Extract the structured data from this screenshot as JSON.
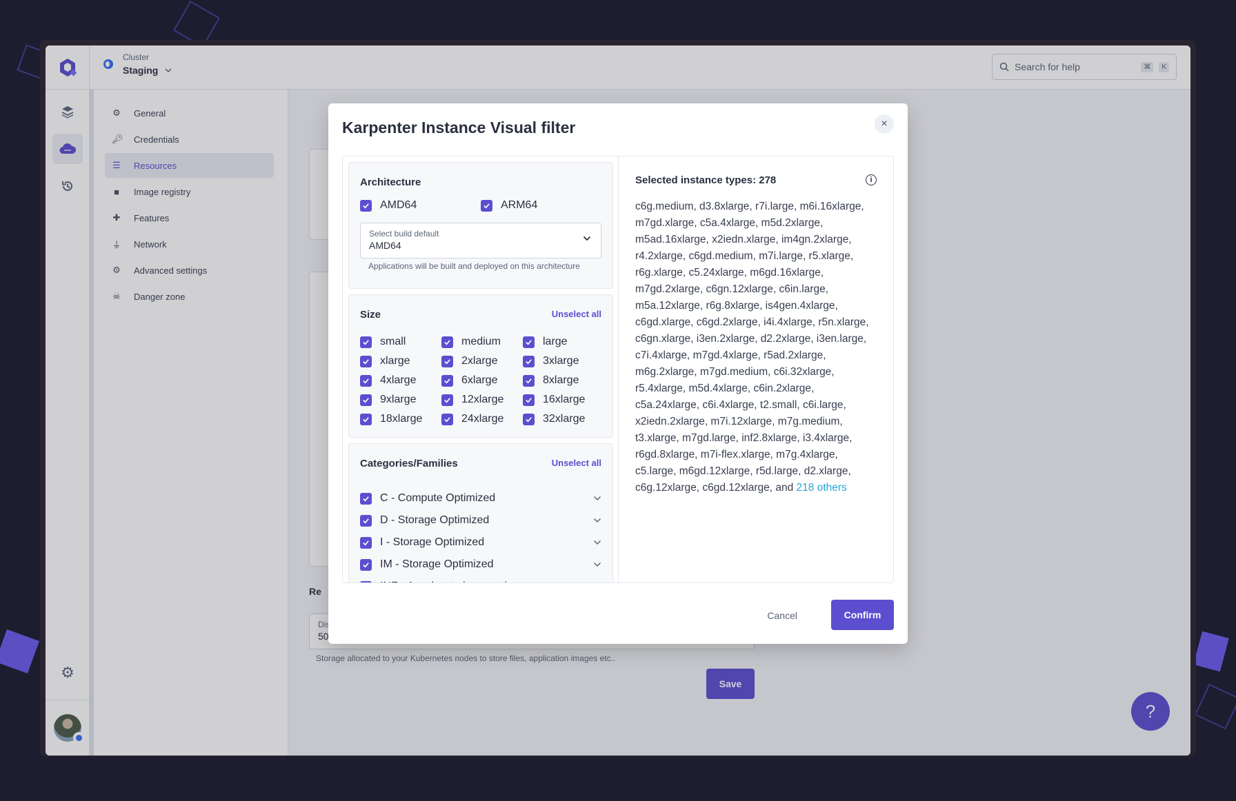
{
  "header": {
    "cluster_label": "Cluster",
    "cluster_name": "Staging",
    "search_placeholder": "Search for help",
    "shortcut_keys": [
      "⌘",
      "K"
    ]
  },
  "rail": {
    "items": [
      {
        "icon": "layers-icon"
      },
      {
        "icon": "cloud-icon",
        "active": true
      },
      {
        "icon": "history-icon"
      }
    ],
    "bottom": {
      "icon": "gear-icon"
    }
  },
  "nav": {
    "items": [
      {
        "label": "General",
        "icon": "gear-icon"
      },
      {
        "label": "Credentials",
        "icon": "key-icon"
      },
      {
        "label": "Resources",
        "icon": "sliders-icon",
        "active": true
      },
      {
        "label": "Image registry",
        "icon": "box-icon"
      },
      {
        "label": "Features",
        "icon": "puzzle-icon"
      },
      {
        "label": "Network",
        "icon": "plug-icon"
      },
      {
        "label": "Advanced settings",
        "icon": "gears-icon"
      },
      {
        "label": "Danger zone",
        "icon": "skull-icon"
      }
    ]
  },
  "content": {
    "section_title": "Re",
    "disk_label": "Disk size (GB)",
    "disk_value": "50",
    "disk_hint": "Storage allocated to your Kubernetes nodes to store files, application images etc..",
    "save_label": "Save",
    "help_label": "?"
  },
  "modal": {
    "title": "Karpenter Instance Visual filter",
    "close_label": "×",
    "architecture": {
      "title": "Architecture",
      "options": [
        {
          "label": "AMD64",
          "checked": true
        },
        {
          "label": "ARM64",
          "checked": true
        }
      ],
      "select_label": "Select build default",
      "select_value": "AMD64",
      "select_hint": "Applications will be built and deployed on this architecture"
    },
    "size": {
      "title": "Size",
      "unselect_label": "Unselect all",
      "options": [
        {
          "label": "small",
          "checked": true
        },
        {
          "label": "medium",
          "checked": true
        },
        {
          "label": "large",
          "checked": true
        },
        {
          "label": "xlarge",
          "checked": true
        },
        {
          "label": "2xlarge",
          "checked": true
        },
        {
          "label": "3xlarge",
          "checked": true
        },
        {
          "label": "4xlarge",
          "checked": true
        },
        {
          "label": "6xlarge",
          "checked": true
        },
        {
          "label": "8xlarge",
          "checked": true
        },
        {
          "label": "9xlarge",
          "checked": true
        },
        {
          "label": "12xlarge",
          "checked": true
        },
        {
          "label": "16xlarge",
          "checked": true
        },
        {
          "label": "18xlarge",
          "checked": true
        },
        {
          "label": "24xlarge",
          "checked": true
        },
        {
          "label": "32xlarge",
          "checked": true
        }
      ]
    },
    "categories": {
      "title": "Categories/Families",
      "unselect_label": "Unselect all",
      "options": [
        {
          "label": "C - Compute Optimized",
          "checked": true
        },
        {
          "label": "D - Storage Optimized",
          "checked": true
        },
        {
          "label": "I - Storage Optimized",
          "checked": true
        },
        {
          "label": "IM - Storage Optimized",
          "checked": true
        },
        {
          "label": "INF - Accelerated computing",
          "checked": true
        }
      ]
    },
    "selected": {
      "title": "Selected instance types: 278",
      "list_text": "c6g.medium, d3.8xlarge, r7i.large, m6i.16xlarge, m7gd.xlarge, c5a.4xlarge, m5d.2xlarge, m5ad.16xlarge, x2iedn.xlarge, im4gn.2xlarge, r4.2xlarge, c6gd.medium, m7i.large, r5.xlarge, r6g.xlarge, c5.24xlarge, m6gd.16xlarge, m7gd.2xlarge, c6gn.12xlarge, c6in.large, m5a.12xlarge, r6g.8xlarge, is4gen.4xlarge, c6gd.xlarge, c6gd.2xlarge, i4i.4xlarge, r5n.xlarge, c6gn.xlarge, i3en.2xlarge, d2.2xlarge, i3en.large, c7i.4xlarge, m7gd.4xlarge, r5ad.2xlarge, m6g.2xlarge, m7gd.medium, c6i.32xlarge, r5.4xlarge, m5d.4xlarge, c6in.2xlarge, c5a.24xlarge, c6i.4xlarge, t2.small, c6i.large, x2iedn.2xlarge, m7i.12xlarge, m7g.medium, t3.xlarge, m7gd.large, inf2.8xlarge, i3.4xlarge, r6gd.8xlarge, m7i-flex.xlarge, m7g.4xlarge, c5.large, m6gd.12xlarge, r5d.large, d2.xlarge, c6g.12xlarge, c6gd.12xlarge, and ",
      "others_link": "218 others"
    },
    "cancel_label": "Cancel",
    "confirm_label": "Confirm"
  },
  "colors": {
    "accent": "#5b4fd0",
    "link": "#2aa4d6",
    "background": "#1c1d2e"
  }
}
